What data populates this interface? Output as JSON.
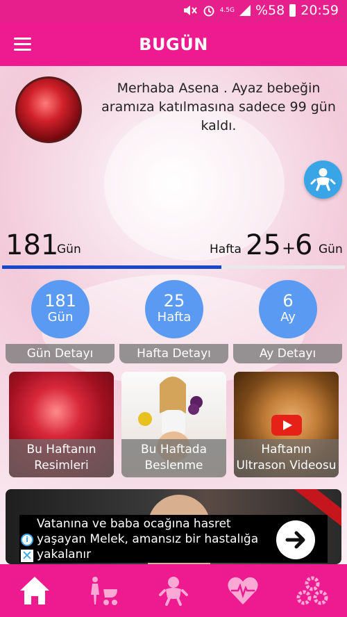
{
  "status_bar": {
    "network": "4.5G",
    "battery": "%58",
    "time": "20:59",
    "icons": [
      "mute-icon",
      "alarm-icon",
      "signal-icon",
      "battery-icon"
    ]
  },
  "app_bar": {
    "title": "BUGÜN",
    "menu_icon": "hamburger-icon"
  },
  "greeting": {
    "text": "Merhaba Asena . Ayaz bebeğin aramıza katılmasına sadece 99 gün kaldı."
  },
  "fab_icon": "baby-icon",
  "counter": {
    "days": "181",
    "days_label": "Gün",
    "week_label": "Hafta",
    "weeks": "25",
    "plus": "+",
    "extra_days": "6",
    "extra_days_label": "Gün",
    "progress_fraction": 0.64
  },
  "details": [
    {
      "number": "181",
      "unit": "Gün",
      "label": "Gün Detayı"
    },
    {
      "number": "25",
      "unit": "Hafta",
      "label": "Hafta Detayı"
    },
    {
      "number": "6",
      "unit": "Ay",
      "label": "Ay Detayı"
    }
  ],
  "tiles": [
    {
      "line1": "Bu Haftanın",
      "line2": "Resimleri"
    },
    {
      "line1": "Bu Haftada",
      "line2": "Beslenme"
    },
    {
      "line1": "Haftanın",
      "line2": "Ultrason Videosu"
    }
  ],
  "ad": {
    "text": "Vatanına ve baba ocağına hasret yaşayan Melek, amansız bir hastalığa yakalanır",
    "info_icon": "info-icon",
    "close_icon": "close-icon",
    "arrow_icon": "arrow-right-icon"
  },
  "bottom_nav": [
    "home-icon",
    "stroller-icon",
    "baby-icon",
    "heartbeat-icon",
    "gears-icon"
  ],
  "colors": {
    "brand": "#ee1a90",
    "accent_blue": "#5a9af2",
    "progress": "#1a47c9",
    "fab": "#3aa5e6"
  }
}
